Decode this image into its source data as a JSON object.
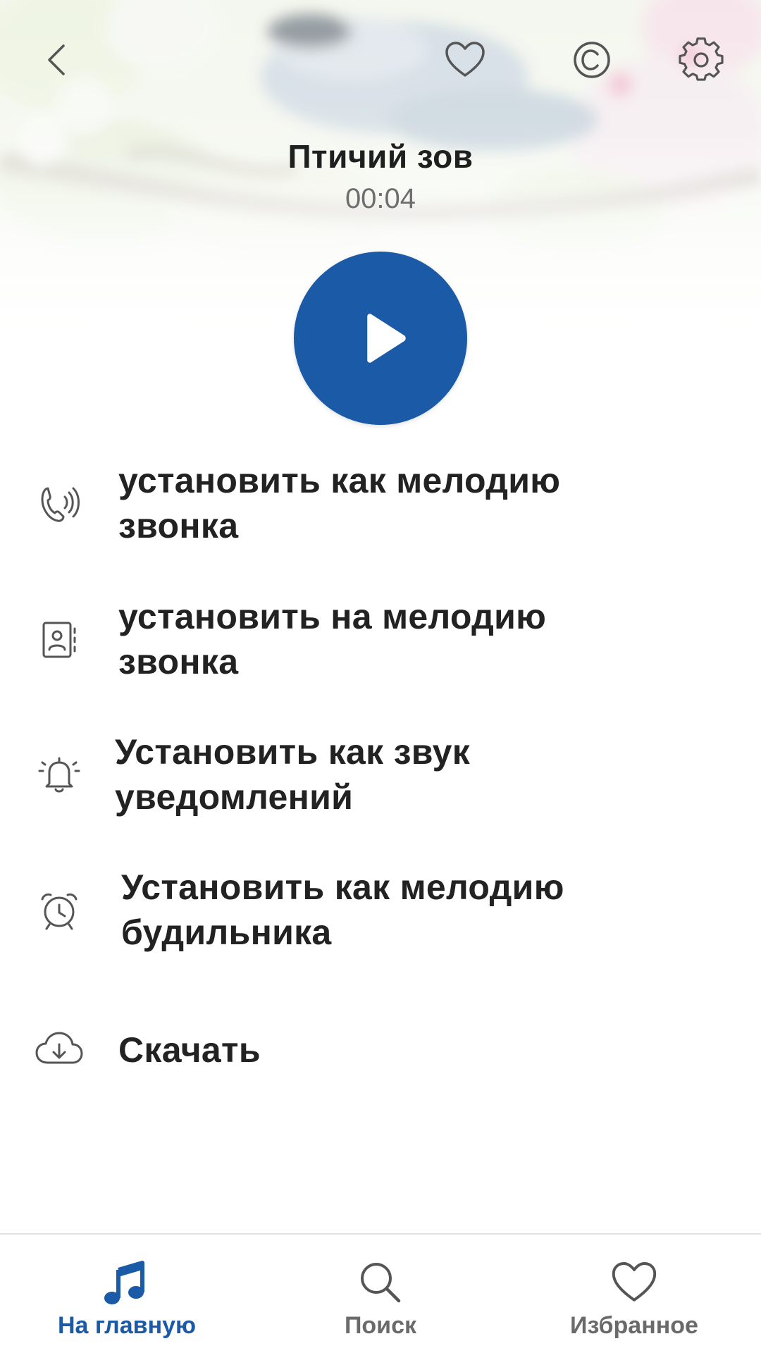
{
  "colors": {
    "accent": "#1b5aa6",
    "text_primary": "#222222",
    "text_secondary": "#6e6e6e",
    "nav_inactive": "#6a6a6a",
    "icon_gray": "#555555"
  },
  "header": {
    "back_icon": "chevron-left-icon",
    "favorite_icon": "heart-outline-icon",
    "copyright_icon": "copyright-icon",
    "settings_icon": "gear-icon"
  },
  "player": {
    "title": "Птичий зов",
    "duration": "00:04",
    "play_icon": "play-icon"
  },
  "actions": [
    {
      "icon": "ringing-phone-icon",
      "label": "установить как мелодию звонка"
    },
    {
      "icon": "contact-card-icon",
      "label": "установить на мелодию звонка"
    },
    {
      "icon": "bell-icon",
      "label": "Установить как звук уведомлений"
    },
    {
      "icon": "alarm-clock-icon",
      "label": "Установить как мелодию будильника"
    },
    {
      "icon": "cloud-download-icon",
      "label": "Скачать"
    }
  ],
  "bottom_nav": {
    "items": [
      {
        "icon": "music-note-icon",
        "label": "На главную",
        "active": true
      },
      {
        "icon": "search-icon",
        "label": "Поиск",
        "active": false
      },
      {
        "icon": "heart-outline-icon",
        "label": "Избранное",
        "active": false
      }
    ]
  }
}
